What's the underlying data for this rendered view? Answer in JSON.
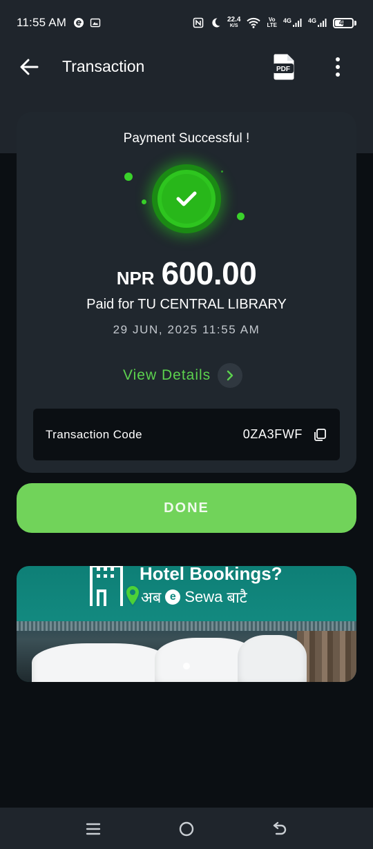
{
  "status_bar": {
    "time": "11:55 AM",
    "net_speed_value": "22.4",
    "net_speed_unit": "K/S",
    "volte_top": "Vo",
    "volte_bottom": "LTE",
    "sim1": "4G",
    "sim2": "4G",
    "battery": "47",
    "icons": [
      "e-icon",
      "screenshot-icon",
      "nfc-icon",
      "moon-icon",
      "wifi-icon",
      "signal-icon",
      "battery-icon"
    ]
  },
  "app_bar": {
    "title": "Transaction",
    "pdf_label": "PDF",
    "icons": [
      "back-arrow-icon",
      "pdf-icon",
      "more-vert-icon"
    ]
  },
  "receipt": {
    "status": "Payment Successful !",
    "currency": "NPR",
    "amount": "600.00",
    "paid_for": "Paid for TU CENTRAL LIBRARY",
    "date": "29 JUN, 2025 11:55 AM",
    "view_details": "View Details",
    "transaction_code_label": "Transaction Code",
    "transaction_code": "0ZA3FWF"
  },
  "done_button": "DONE",
  "banner": {
    "title": "Hotel Bookings?",
    "sub_prefix": "अब",
    "e_letter": "e",
    "brand": "Sewa",
    "sub_suffix": "बाटै"
  },
  "colors": {
    "accent_green": "#71d35a",
    "link_green": "#5cd24e",
    "success_green": "#2ec51f",
    "card_bg": "#20272e",
    "page_bg": "#0b0f13"
  }
}
